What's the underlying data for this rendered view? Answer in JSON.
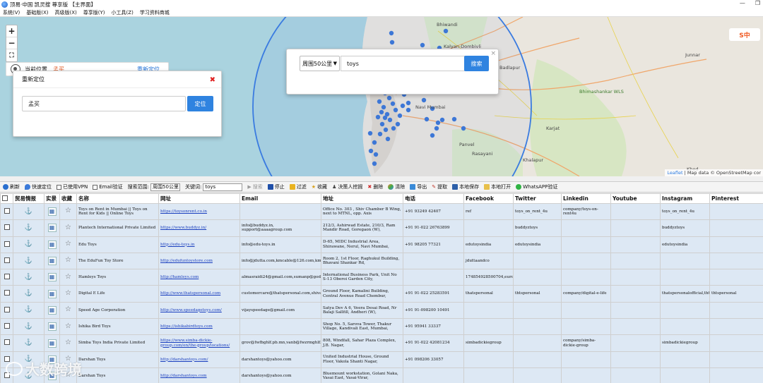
{
  "app": {
    "title": "顶易·中国 凯灵搜 尊享版 【主界面】",
    "window_buttons": [
      "—",
      "❐"
    ]
  },
  "menu": [
    "系统(V)",
    "基础版(X)",
    "高级版(X)",
    "尊享版(Y)",
    "小工具(Z)",
    "学习资料商城"
  ],
  "map": {
    "zoom_in": "+",
    "zoom_out": "−",
    "fullscreen": "⛶",
    "current_location_label": "当前位置",
    "current_city": "孟买",
    "relocate_link": "重新定位",
    "relocate_panel": {
      "title": "重新定位",
      "close": "✖",
      "input_value": "孟买",
      "button": "定位"
    },
    "search_panel": {
      "radius_selected": "周围50公里",
      "keyword": "toys",
      "search_button": "搜索",
      "close": "×"
    },
    "place_labels": [
      "Bhiwandi",
      "Kalyan-Dombivli",
      "Badlapur",
      "Navi Mumbai",
      "Panvel",
      "Karjat",
      "Junnar",
      "Bhimashankar WLS",
      "Rasayani",
      "Khalapur",
      "Khed"
    ],
    "attribution_leaflet": "Leaflet",
    "attribution_rest": " | Map data © OpenStreetMap cor",
    "sogou_badge": "S中"
  },
  "toolbar": {
    "refresh": "刷新",
    "quick_locate": "快速定位",
    "vpn_label": "已使用VPN",
    "email_verify": "Email验证",
    "search_range_label": "搜索范围:",
    "search_range_value": "周围50公里",
    "keyword_label": "关键词:",
    "keyword_value": "toys",
    "search": "搜索",
    "stop": "停止",
    "filter": "过滤",
    "favorite": "收藏",
    "decision_maker": "决策人挖掘",
    "delete": "删除",
    "clear": "清除",
    "export": "导出",
    "extract": "提取",
    "save_local": "本地保存",
    "open_local": "本地打开",
    "whatsapp_verify": "WhatsAPP验证"
  },
  "table": {
    "columns": [
      "贸易情报",
      "实景",
      "收藏",
      "名称",
      "网址",
      "Email",
      "地址",
      "电话",
      "Facebook",
      "Twitter",
      "Linkedin",
      "Youtube",
      "Instagram",
      "Pinterest"
    ],
    "rows": [
      {
        "anchor": "gray",
        "name": "Toys on Rent in Mumbai || Toys on Rent for Kids || Online Toys",
        "web": "https://toysonrent.co.in",
        "email": "",
        "address": "Office No. 303 , Shiv Chamber B Wing, next to MTNL, opp. Axis",
        "phone": "+91 93249 42407",
        "facebook": "ref",
        "twitter": "toys_on_rent_4u",
        "linkedin": "company/toys-on-rent4u",
        "youtube": "",
        "instagram": "toys_on_rent_4u",
        "pinterest": ""
      },
      {
        "anchor": "red",
        "name": "Plantech International Private Limited",
        "web": "https://www.buddyz.in/",
        "email": "info@buddyz.in, support@aaaagroup.com",
        "address": "212/3, Ashirwad Estate, 210/3, Ram Mandir Road, Goregaon (W),",
        "phone": "+91 91-022 26763899",
        "facebook": "",
        "twitter": "buddyztoys",
        "linkedin": "",
        "youtube": "",
        "instagram": "buddyztoys",
        "pinterest": ""
      },
      {
        "anchor": "gray",
        "name": "Edu Toys",
        "web": "http://edu-toys.in",
        "email": "info@edu-toys.in",
        "address": "D-65, MIDC Industrial Area, Shirawane, Nerul, Navi Mumbai,",
        "phone": "+91 98205 77321",
        "facebook": "edutoysindia",
        "twitter": "edutoysindia",
        "linkedin": "",
        "youtube": "",
        "instagram": "edutoysindia",
        "pinterest": ""
      },
      {
        "anchor": "gray",
        "name": "The EduFun Toy Store",
        "web": "http://edufuntoystore.com",
        "email": "info@jdutta.com,kmcable@126.com,kmcablers@china.com,kndlgroup@ya",
        "address": "Room 2, 1st Floor, Raghukul Building, Bhavani Shankar Rd,",
        "phone": "",
        "facebook": "jduttaandco",
        "twitter": "",
        "linkedin": "",
        "youtube": "",
        "instagram": "",
        "pinterest": ""
      },
      {
        "anchor": "gray",
        "name": "Hamleys Toys",
        "web": "http://hamleys.com",
        "email": "almasraidi24@gmail.com,sumanp@godrej.com,ssaith@hamleys.co.uk,je",
        "address": "International Business Park, Unit No S-13 Oberoi Garden City,",
        "phone": "",
        "facebook": "174854928500704,europages,hamleys.in,",
        "twitter": "",
        "linkedin": "",
        "youtube": "",
        "instagram": "",
        "pinterest": ""
      },
      {
        "anchor": "red",
        "name": "Digital E Life",
        "web": "http://www.thatspersonal.com",
        "email": "customercare@thatspersonal.com,shivam.bhatkar@hcod.co.in,jaspree",
        "address": "Ground Floor, Kamalini Building, Central Avenue Road Chembur,",
        "phone": "+91 91-022 25283591",
        "facebook": "thatspersonal",
        "twitter": "thtspersonal",
        "linkedin": "company/digital-e-life",
        "youtube": "",
        "instagram": "thatspersonalofficial,thtspersonal",
        "pinterest": "thtspersonal"
      },
      {
        "anchor": "red",
        "name": "Speed Age Corporation",
        "web": "http://www.speedagetoys.com/",
        "email": "vijayspeedage@gmail.com",
        "address": "Satya Dev A 6, Veera Desai Road, Nr Balaji Sallfill, Andheri (W),",
        "phone": "+91 91-098200 10491",
        "facebook": "",
        "twitter": "",
        "linkedin": "",
        "youtube": "",
        "instagram": "",
        "pinterest": ""
      },
      {
        "anchor": "gray",
        "name": "Ishika Bird Toys",
        "web": "https://ishikabirdtoys.com",
        "email": "",
        "address": "Shop No. 5, Sarova Tower, Thakur Village, Kandivali East, Mumbai,",
        "phone": "+91 95941 33337",
        "facebook": "",
        "twitter": "",
        "linkedin": "",
        "youtube": "",
        "instagram": "",
        "pinterest": ""
      },
      {
        "anchor": "gray",
        "name": "Simba Toys India Private Limited",
        "web": "https://www.simba-dickie-group.com/en/the-group/locations/",
        "email": "grov@fwfbghlf.pb.mn,vanb@fwzrmghlf.pu,evpb@evpb.rf,vanb@fwzmghl",
        "address": "808, Windfall, Sahar Plaza Complex, J.B. Nagar,",
        "phone": "+91 91-022 42081234",
        "facebook": "simbadickiegroup",
        "twitter": "",
        "linkedin": "company/simba-dickie-group",
        "youtube": "",
        "instagram": "simbadickiegroup",
        "pinterest": ""
      },
      {
        "anchor": "red",
        "name": "Darshan Toys",
        "web": "http://darshantoys.com/",
        "email": "darshantoys@yahoo.com",
        "address": "United Industrial House, Ground Floor, Vakola Shanti Nagar,",
        "phone": "+91 098206 33057",
        "facebook": "",
        "twitter": "",
        "linkedin": "",
        "youtube": "",
        "instagram": "",
        "pinterest": ""
      },
      {
        "anchor": "red",
        "name": "Darshan Toys",
        "web": "http://darshantoys.com",
        "email": "darshantoys@yahoo.com",
        "address": "Bluemount workstation, Golani Naka, Vasai East, Vasai-Virar,",
        "phone": "",
        "facebook": "",
        "twitter": "",
        "linkedin": "",
        "youtube": "",
        "instagram": "",
        "pinterest": ""
      }
    ]
  },
  "watermark": "大数跨境"
}
